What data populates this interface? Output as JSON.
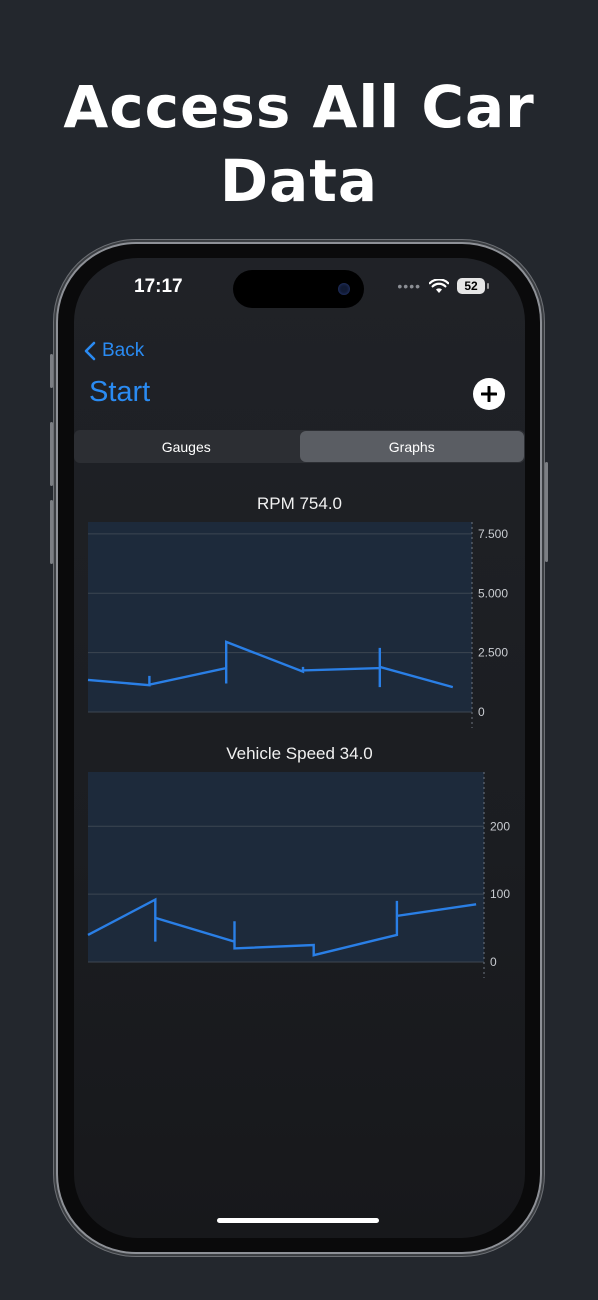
{
  "headline": {
    "line1": "Access All Car",
    "line2": "Data"
  },
  "status_bar": {
    "time": "17:17",
    "battery": "52"
  },
  "nav": {
    "back_label": "Back",
    "title": "Start"
  },
  "tabs": [
    {
      "label": "Gauges",
      "active": false
    },
    {
      "label": "Graphs",
      "active": true
    }
  ],
  "colors": {
    "accent": "#2a8bf2",
    "line": "#2a7fe6",
    "plot_bg": "#1d2a3b"
  },
  "chart_data": [
    {
      "type": "line",
      "title": "RPM 754.0",
      "ytick_labels": [
        "7.500",
        "5.000",
        "2.500",
        "0"
      ],
      "yticks": [
        7500,
        5000,
        2500,
        0
      ],
      "ylim": [
        0,
        8000
      ],
      "xlim": [
        0,
        10
      ],
      "series": [
        {
          "points": [
            [
              0,
              1350
            ],
            [
              1.6,
              1130
            ],
            [
              1.6,
              1520
            ],
            [
              1.6,
              1150
            ],
            [
              3.6,
              1850
            ],
            [
              3.6,
              1200
            ],
            [
              3.6,
              2950
            ],
            [
              5.6,
              1700
            ],
            [
              5.6,
              1900
            ],
            [
              5.6,
              1750
            ],
            [
              7.6,
              1850
            ],
            [
              7.6,
              1050
            ],
            [
              7.6,
              2700
            ],
            [
              7.6,
              1900
            ],
            [
              9.5,
              1050
            ]
          ]
        }
      ]
    },
    {
      "type": "line",
      "title": "Vehicle Speed 34.0",
      "ytick_labels": [
        "200",
        "100",
        "0"
      ],
      "yticks": [
        200,
        100,
        0
      ],
      "ylim": [
        0,
        280
      ],
      "xlim": [
        0,
        10
      ],
      "series": [
        {
          "points": [
            [
              0,
              40
            ],
            [
              1.7,
              92
            ],
            [
              1.7,
              30
            ],
            [
              1.7,
              65
            ],
            [
              3.7,
              30
            ],
            [
              3.7,
              60
            ],
            [
              3.7,
              20
            ],
            [
              5.7,
              25
            ],
            [
              5.7,
              10
            ],
            [
              7.8,
              40
            ],
            [
              7.8,
              90
            ],
            [
              7.8,
              68
            ],
            [
              9.8,
              85
            ]
          ]
        }
      ]
    }
  ]
}
